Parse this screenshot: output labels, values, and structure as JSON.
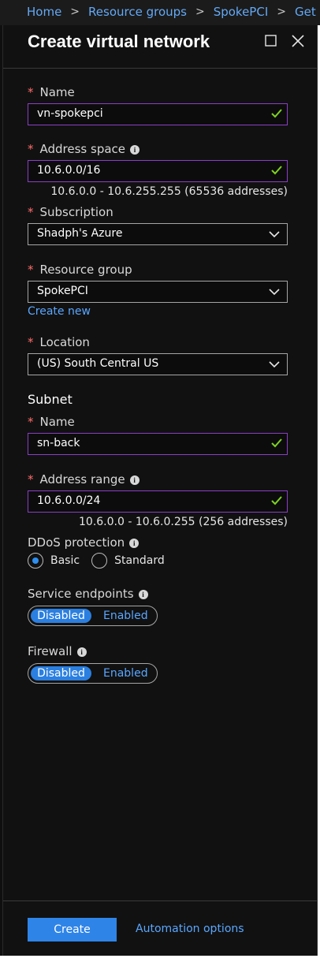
{
  "breadcrumb": {
    "items": [
      "Home",
      "Resource groups",
      "SpokePCI",
      "Get Star"
    ],
    "separator": ">"
  },
  "panel": {
    "title": "Create virtual network",
    "maximize_icon": "maximize-icon",
    "close_icon": "close-icon"
  },
  "form": {
    "name": {
      "label": "Name",
      "value": "vn-spokepci",
      "required_mark": "*"
    },
    "address_space": {
      "label": "Address space",
      "value": "10.6.0.0/16",
      "hint": "10.6.0.0 - 10.6.255.255 (65536 addresses)",
      "required_mark": "*"
    },
    "subscription": {
      "label": "Subscription",
      "value": "Shadph's Azure",
      "required_mark": "*"
    },
    "resource_group": {
      "label": "Resource group",
      "value": "SpokePCI",
      "create_new": "Create new",
      "required_mark": "*"
    },
    "location": {
      "label": "Location",
      "value": "(US) South Central US",
      "required_mark": "*"
    }
  },
  "subnet": {
    "title": "Subnet",
    "name": {
      "label": "Name",
      "value": "sn-back",
      "required_mark": "*"
    },
    "address_range": {
      "label": "Address range",
      "value": "10.6.0.0/24",
      "hint": "10.6.0.0 - 10.6.0.255 (256 addresses)",
      "required_mark": "*"
    }
  },
  "ddos": {
    "label": "DDoS protection",
    "options": [
      "Basic",
      "Standard"
    ],
    "selected": "Basic"
  },
  "service_endpoints": {
    "label": "Service endpoints",
    "options": [
      "Disabled",
      "Enabled"
    ],
    "selected": "Disabled"
  },
  "firewall": {
    "label": "Firewall",
    "options": [
      "Disabled",
      "Enabled"
    ],
    "selected": "Disabled"
  },
  "footer": {
    "create_label": "Create",
    "automation_label": "Automation options"
  },
  "colors": {
    "accent": "#2f84e8",
    "link": "#5aa7ff",
    "valid_check": "#7ed321",
    "input_border_focus": "#8a3fc6",
    "required": "#ff6b6b"
  }
}
